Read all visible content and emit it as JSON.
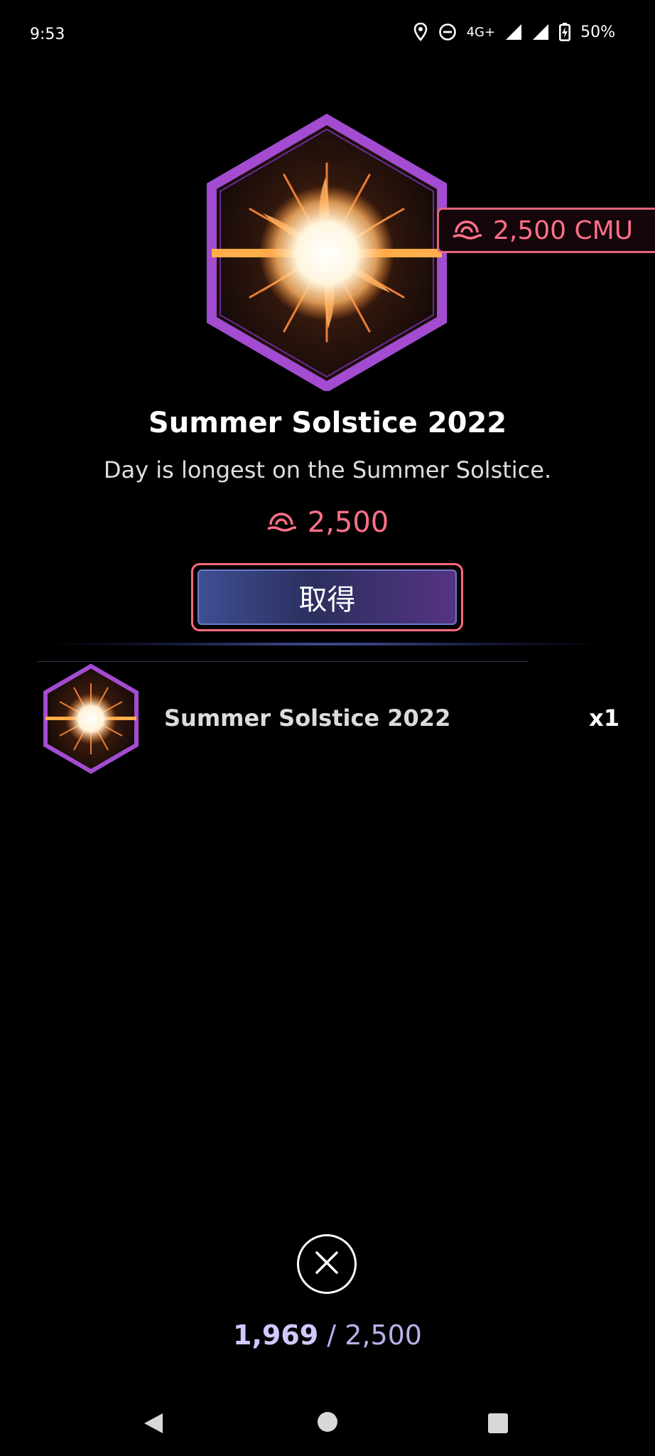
{
  "status_bar": {
    "time": "9:53",
    "network": "4G+",
    "battery": "50%"
  },
  "reward": {
    "price_tag": "2,500 CMU",
    "title": "Summer Solstice 2022",
    "description": "Day is longest on the Summer Solstice.",
    "price": "2,500",
    "acquire_label": "取得"
  },
  "item": {
    "name": "Summer Solstice 2022",
    "count": "x1"
  },
  "balance": {
    "current": "1,969",
    "separator": " / ",
    "total": "2,500"
  },
  "colors": {
    "accent_pink": "#ff6f88",
    "hex_border": "#a846d0",
    "sun_core": "#ffffff",
    "sun_orange": "#ff9a3c"
  },
  "icons": {
    "location": "location-icon",
    "dnd": "do-not-disturb-icon",
    "signal": "signal-icon",
    "battery": "battery-charging-icon",
    "currency": "cmu-currency-icon",
    "close": "close-icon",
    "back": "nav-back-icon",
    "home": "nav-home-icon",
    "recents": "nav-recents-icon"
  }
}
